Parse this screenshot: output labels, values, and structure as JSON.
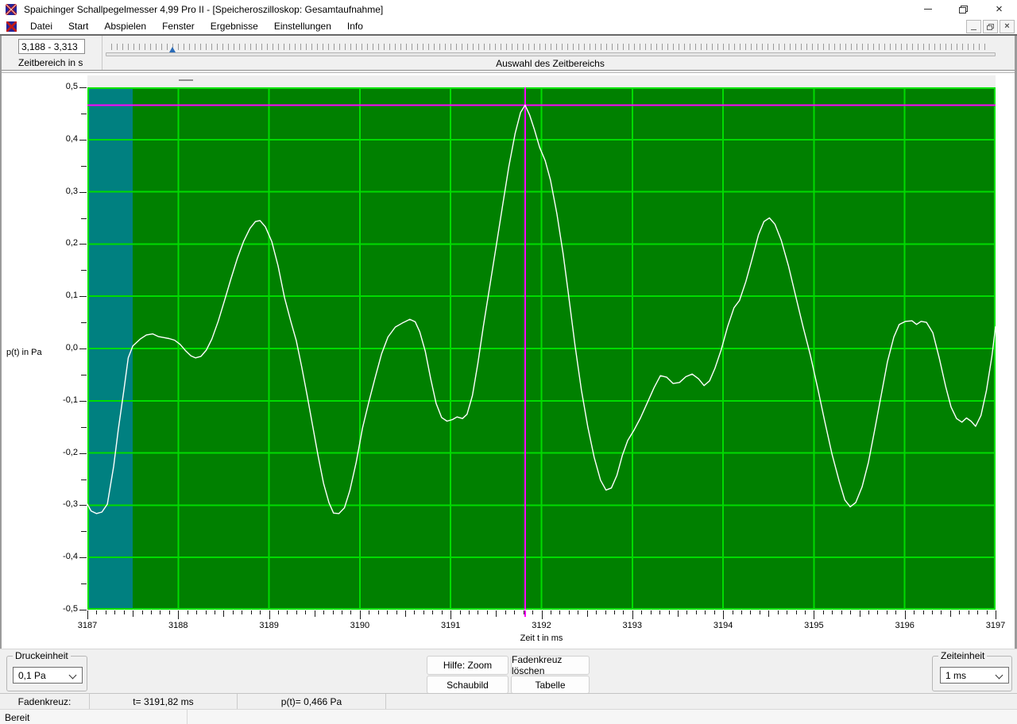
{
  "window": {
    "title": "Spaichinger Schallpegelmesser 4,99 Pro II - [Speicheroszilloskop: Gesamtaufnahme]"
  },
  "menu": {
    "items": [
      "Datei",
      "Start",
      "Abspielen",
      "Fenster",
      "Ergebnisse",
      "Einstellungen",
      "Info"
    ]
  },
  "toolbar": {
    "range_value": "3,188 - 3,313",
    "range_label": "Zeitbereich in s",
    "slider_label": "Auswahl des Zeitbereichs"
  },
  "controls": {
    "druckeinheit_label": "Druckeinheit",
    "druckeinheit_selected": "0,1 Pa",
    "zeiteinheit_label": "Zeiteinheit",
    "zeiteinheit_selected": "1 ms",
    "buttons": [
      "Hilfe: Zoom",
      "Fadenkreuz löschen",
      "Schaubild",
      "Tabelle"
    ]
  },
  "status": {
    "fadenkreuz": "Fadenkreuz:",
    "t_value": "t= 3191,82 ms",
    "p_value": "p(t)= 0,466 Pa",
    "ready": "Bereit"
  },
  "icons": {
    "close": "×",
    "mdi_close": "×"
  },
  "colors": {
    "plot_background": "#008000",
    "grid": "#00dc00",
    "plot_border": "#00e400",
    "selection_region": "#008080",
    "crosshair": "#ff00ff",
    "waveform": "#ffffff",
    "slider_thumb": "#2b6cb8"
  },
  "chart_data": {
    "type": "line",
    "xlabel": "Zeit t in ms",
    "ylabel": "p(t) in Pa",
    "xlim": [
      3187,
      3197
    ],
    "ylim": [
      -0.5,
      0.5
    ],
    "x_major_ticks": [
      3187,
      3188,
      3189,
      3190,
      3191,
      3192,
      3193,
      3194,
      3195,
      3196,
      3197
    ],
    "x_tick_labels": [
      "3187",
      "3188",
      "3189",
      "3190",
      "3191",
      "3192",
      "3193",
      "3194",
      "3195",
      "3196",
      "3197"
    ],
    "x_minor_step": 0.1,
    "y_major_ticks": [
      0.5,
      0.4,
      0.3,
      0.2,
      0.1,
      0.0,
      -0.1,
      -0.2,
      -0.3,
      -0.4,
      -0.5
    ],
    "y_tick_labels": [
      "0,5",
      "0,4",
      "0,3",
      "0,2",
      "0,1",
      "0,0",
      "-0,1",
      "-0,2",
      "-0,3",
      "-0,4",
      "-0,5"
    ],
    "y_minor_step": 0.05,
    "grid": true,
    "selection_region": {
      "t_start": 3187.0,
      "t_end": 3187.5
    },
    "crosshair": {
      "t": 3191.82,
      "p": 0.466
    },
    "series": [
      {
        "name": "p(t)",
        "points": [
          [
            3187.0,
            -0.298
          ],
          [
            3187.04,
            -0.311
          ],
          [
            3187.1,
            -0.316
          ],
          [
            3187.16,
            -0.313
          ],
          [
            3187.22,
            -0.298
          ],
          [
            3187.29,
            -0.225
          ],
          [
            3187.34,
            -0.155
          ],
          [
            3187.4,
            -0.082
          ],
          [
            3187.45,
            -0.018
          ],
          [
            3187.5,
            0.005
          ],
          [
            3187.58,
            0.018
          ],
          [
            3187.65,
            0.026
          ],
          [
            3187.72,
            0.028
          ],
          [
            3187.78,
            0.023
          ],
          [
            3187.84,
            0.021
          ],
          [
            3187.9,
            0.019
          ],
          [
            3187.96,
            0.016
          ],
          [
            3188.02,
            0.008
          ],
          [
            3188.08,
            -0.004
          ],
          [
            3188.14,
            -0.014
          ],
          [
            3188.19,
            -0.018
          ],
          [
            3188.25,
            -0.015
          ],
          [
            3188.31,
            -0.003
          ],
          [
            3188.37,
            0.018
          ],
          [
            3188.44,
            0.052
          ],
          [
            3188.51,
            0.092
          ],
          [
            3188.58,
            0.133
          ],
          [
            3188.65,
            0.172
          ],
          [
            3188.72,
            0.205
          ],
          [
            3188.79,
            0.23
          ],
          [
            3188.85,
            0.243
          ],
          [
            3188.9,
            0.245
          ],
          [
            3188.96,
            0.233
          ],
          [
            3189.03,
            0.205
          ],
          [
            3189.1,
            0.158
          ],
          [
            3189.17,
            0.098
          ],
          [
            3189.24,
            0.052
          ],
          [
            3189.3,
            0.015
          ],
          [
            3189.36,
            -0.035
          ],
          [
            3189.42,
            -0.09
          ],
          [
            3189.48,
            -0.148
          ],
          [
            3189.54,
            -0.205
          ],
          [
            3189.6,
            -0.258
          ],
          [
            3189.66,
            -0.295
          ],
          [
            3189.71,
            -0.315
          ],
          [
            3189.77,
            -0.316
          ],
          [
            3189.83,
            -0.305
          ],
          [
            3189.89,
            -0.272
          ],
          [
            3189.96,
            -0.218
          ],
          [
            3190.03,
            -0.152
          ],
          [
            3190.1,
            -0.102
          ],
          [
            3190.17,
            -0.055
          ],
          [
            3190.24,
            -0.01
          ],
          [
            3190.31,
            0.022
          ],
          [
            3190.39,
            0.041
          ],
          [
            3190.47,
            0.049
          ],
          [
            3190.55,
            0.056
          ],
          [
            3190.61,
            0.051
          ],
          [
            3190.66,
            0.032
          ],
          [
            3190.72,
            -0.005
          ],
          [
            3190.78,
            -0.058
          ],
          [
            3190.84,
            -0.105
          ],
          [
            3190.9,
            -0.132
          ],
          [
            3190.96,
            -0.139
          ],
          [
            3191.02,
            -0.136
          ],
          [
            3191.07,
            -0.131
          ],
          [
            3191.13,
            -0.134
          ],
          [
            3191.18,
            -0.126
          ],
          [
            3191.24,
            -0.09
          ],
          [
            3191.3,
            -0.028
          ],
          [
            3191.36,
            0.042
          ],
          [
            3191.43,
            0.118
          ],
          [
            3191.5,
            0.195
          ],
          [
            3191.57,
            0.272
          ],
          [
            3191.64,
            0.348
          ],
          [
            3191.71,
            0.412
          ],
          [
            3191.77,
            0.452
          ],
          [
            3191.82,
            0.466
          ],
          [
            3191.87,
            0.447
          ],
          [
            3191.92,
            0.42
          ],
          [
            3191.98,
            0.385
          ],
          [
            3192.04,
            0.36
          ],
          [
            3192.1,
            0.322
          ],
          [
            3192.17,
            0.258
          ],
          [
            3192.24,
            0.18
          ],
          [
            3192.3,
            0.1
          ],
          [
            3192.37,
            0.005
          ],
          [
            3192.44,
            -0.08
          ],
          [
            3192.51,
            -0.15
          ],
          [
            3192.58,
            -0.208
          ],
          [
            3192.65,
            -0.252
          ],
          [
            3192.71,
            -0.271
          ],
          [
            3192.77,
            -0.267
          ],
          [
            3192.83,
            -0.243
          ],
          [
            3192.89,
            -0.205
          ],
          [
            3192.95,
            -0.176
          ],
          [
            3193.02,
            -0.156
          ],
          [
            3193.09,
            -0.133
          ],
          [
            3193.16,
            -0.106
          ],
          [
            3193.24,
            -0.075
          ],
          [
            3193.31,
            -0.052
          ],
          [
            3193.38,
            -0.055
          ],
          [
            3193.45,
            -0.067
          ],
          [
            3193.52,
            -0.065
          ],
          [
            3193.59,
            -0.054
          ],
          [
            3193.66,
            -0.049
          ],
          [
            3193.73,
            -0.058
          ],
          [
            3193.79,
            -0.071
          ],
          [
            3193.85,
            -0.062
          ],
          [
            3193.91,
            -0.038
          ],
          [
            3193.98,
            -0.002
          ],
          [
            3194.05,
            0.042
          ],
          [
            3194.12,
            0.078
          ],
          [
            3194.18,
            0.092
          ],
          [
            3194.25,
            0.128
          ],
          [
            3194.32,
            0.172
          ],
          [
            3194.39,
            0.218
          ],
          [
            3194.45,
            0.243
          ],
          [
            3194.51,
            0.25
          ],
          [
            3194.57,
            0.238
          ],
          [
            3194.64,
            0.207
          ],
          [
            3194.72,
            0.158
          ],
          [
            3194.8,
            0.1
          ],
          [
            3194.88,
            0.042
          ],
          [
            3194.96,
            -0.012
          ],
          [
            3195.04,
            -0.075
          ],
          [
            3195.12,
            -0.14
          ],
          [
            3195.2,
            -0.203
          ],
          [
            3195.28,
            -0.255
          ],
          [
            3195.34,
            -0.29
          ],
          [
            3195.4,
            -0.303
          ],
          [
            3195.46,
            -0.295
          ],
          [
            3195.53,
            -0.265
          ],
          [
            3195.6,
            -0.218
          ],
          [
            3195.67,
            -0.155
          ],
          [
            3195.74,
            -0.09
          ],
          [
            3195.81,
            -0.025
          ],
          [
            3195.88,
            0.022
          ],
          [
            3195.94,
            0.046
          ],
          [
            3196.01,
            0.052
          ],
          [
            3196.08,
            0.053
          ],
          [
            3196.13,
            0.046
          ],
          [
            3196.18,
            0.052
          ],
          [
            3196.24,
            0.05
          ],
          [
            3196.31,
            0.03
          ],
          [
            3196.38,
            -0.018
          ],
          [
            3196.45,
            -0.072
          ],
          [
            3196.51,
            -0.112
          ],
          [
            3196.57,
            -0.134
          ],
          [
            3196.63,
            -0.141
          ],
          [
            3196.68,
            -0.133
          ],
          [
            3196.73,
            -0.139
          ],
          [
            3196.78,
            -0.149
          ],
          [
            3196.84,
            -0.128
          ],
          [
            3196.9,
            -0.08
          ],
          [
            3196.96,
            -0.015
          ],
          [
            3197.0,
            0.042
          ]
        ]
      }
    ]
  }
}
